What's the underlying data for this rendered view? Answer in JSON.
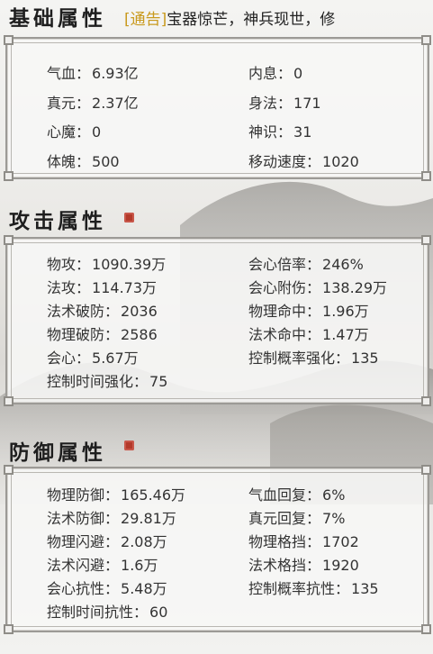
{
  "sections": {
    "basic": {
      "title": "基础属性",
      "stats": [
        {
          "label": "气血",
          "value": "6.93亿"
        },
        {
          "label": "内息",
          "value": "0"
        },
        {
          "label": "真元",
          "value": "2.37亿"
        },
        {
          "label": "身法",
          "value": "171"
        },
        {
          "label": "心魔",
          "value": "0"
        },
        {
          "label": "神识",
          "value": "31"
        },
        {
          "label": "体魄",
          "value": "500"
        },
        {
          "label": "移动速度",
          "value": "1020"
        }
      ]
    },
    "attack": {
      "title": "攻击属性",
      "stats": [
        {
          "label": "物攻",
          "value": "1090.39万"
        },
        {
          "label": "会心倍率",
          "value": "246%"
        },
        {
          "label": "法攻",
          "value": "114.73万"
        },
        {
          "label": "会心附伤",
          "value": "138.29万"
        },
        {
          "label": "法术破防",
          "value": "2036"
        },
        {
          "label": "物理命中",
          "value": "1.96万"
        },
        {
          "label": "物理破防",
          "value": "2586"
        },
        {
          "label": "法术命中",
          "value": "1.47万"
        },
        {
          "label": "会心",
          "value": "5.67万"
        },
        {
          "label": "控制概率强化",
          "value": "135"
        },
        {
          "label": "控制时间强化",
          "value": "75"
        }
      ]
    },
    "defense": {
      "title": "防御属性",
      "stats": [
        {
          "label": "物理防御",
          "value": "165.46万"
        },
        {
          "label": "气血回复",
          "value": "6%"
        },
        {
          "label": "法术防御",
          "value": "29.81万"
        },
        {
          "label": "真元回复",
          "value": "7%"
        },
        {
          "label": "物理闪避",
          "value": "2.08万"
        },
        {
          "label": "物理格挡",
          "value": "1702"
        },
        {
          "label": "法术闪避",
          "value": "1.6万"
        },
        {
          "label": "法术格挡",
          "value": "1920"
        },
        {
          "label": "会心抗性",
          "value": "5.48万"
        },
        {
          "label": "控制概率抗性",
          "value": "135"
        },
        {
          "label": "控制时间抗性",
          "value": "60"
        }
      ]
    }
  },
  "notice": {
    "tag": "通告",
    "bracket_open": "[",
    "bracket_close": "]",
    "text": "宝器惊芒，神兵现世，修"
  },
  "separator": "：",
  "colors": {
    "notice_tag": "#c99a1e",
    "seal": "#b33a2b",
    "text": "#333333"
  }
}
